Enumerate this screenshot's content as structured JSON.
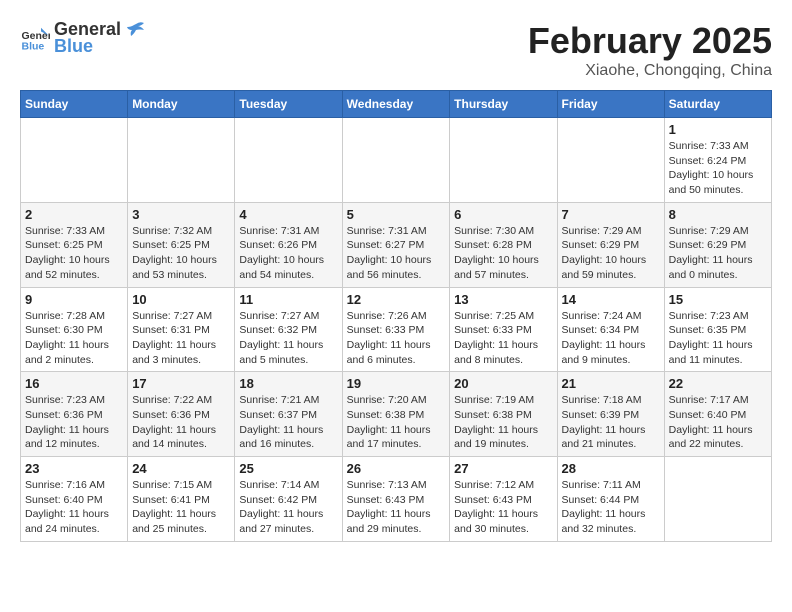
{
  "header": {
    "logo_general": "General",
    "logo_blue": "Blue",
    "title": "February 2025",
    "subtitle": "Xiaohe, Chongqing, China"
  },
  "weekdays": [
    "Sunday",
    "Monday",
    "Tuesday",
    "Wednesday",
    "Thursday",
    "Friday",
    "Saturday"
  ],
  "weeks": [
    [
      {
        "day": "",
        "info": ""
      },
      {
        "day": "",
        "info": ""
      },
      {
        "day": "",
        "info": ""
      },
      {
        "day": "",
        "info": ""
      },
      {
        "day": "",
        "info": ""
      },
      {
        "day": "",
        "info": ""
      },
      {
        "day": "1",
        "info": "Sunrise: 7:33 AM\nSunset: 6:24 PM\nDaylight: 10 hours\nand 50 minutes."
      }
    ],
    [
      {
        "day": "2",
        "info": "Sunrise: 7:33 AM\nSunset: 6:25 PM\nDaylight: 10 hours\nand 52 minutes."
      },
      {
        "day": "3",
        "info": "Sunrise: 7:32 AM\nSunset: 6:25 PM\nDaylight: 10 hours\nand 53 minutes."
      },
      {
        "day": "4",
        "info": "Sunrise: 7:31 AM\nSunset: 6:26 PM\nDaylight: 10 hours\nand 54 minutes."
      },
      {
        "day": "5",
        "info": "Sunrise: 7:31 AM\nSunset: 6:27 PM\nDaylight: 10 hours\nand 56 minutes."
      },
      {
        "day": "6",
        "info": "Sunrise: 7:30 AM\nSunset: 6:28 PM\nDaylight: 10 hours\nand 57 minutes."
      },
      {
        "day": "7",
        "info": "Sunrise: 7:29 AM\nSunset: 6:29 PM\nDaylight: 10 hours\nand 59 minutes."
      },
      {
        "day": "8",
        "info": "Sunrise: 7:29 AM\nSunset: 6:29 PM\nDaylight: 11 hours\nand 0 minutes."
      }
    ],
    [
      {
        "day": "9",
        "info": "Sunrise: 7:28 AM\nSunset: 6:30 PM\nDaylight: 11 hours\nand 2 minutes."
      },
      {
        "day": "10",
        "info": "Sunrise: 7:27 AM\nSunset: 6:31 PM\nDaylight: 11 hours\nand 3 minutes."
      },
      {
        "day": "11",
        "info": "Sunrise: 7:27 AM\nSunset: 6:32 PM\nDaylight: 11 hours\nand 5 minutes."
      },
      {
        "day": "12",
        "info": "Sunrise: 7:26 AM\nSunset: 6:33 PM\nDaylight: 11 hours\nand 6 minutes."
      },
      {
        "day": "13",
        "info": "Sunrise: 7:25 AM\nSunset: 6:33 PM\nDaylight: 11 hours\nand 8 minutes."
      },
      {
        "day": "14",
        "info": "Sunrise: 7:24 AM\nSunset: 6:34 PM\nDaylight: 11 hours\nand 9 minutes."
      },
      {
        "day": "15",
        "info": "Sunrise: 7:23 AM\nSunset: 6:35 PM\nDaylight: 11 hours\nand 11 minutes."
      }
    ],
    [
      {
        "day": "16",
        "info": "Sunrise: 7:23 AM\nSunset: 6:36 PM\nDaylight: 11 hours\nand 12 minutes."
      },
      {
        "day": "17",
        "info": "Sunrise: 7:22 AM\nSunset: 6:36 PM\nDaylight: 11 hours\nand 14 minutes."
      },
      {
        "day": "18",
        "info": "Sunrise: 7:21 AM\nSunset: 6:37 PM\nDaylight: 11 hours\nand 16 minutes."
      },
      {
        "day": "19",
        "info": "Sunrise: 7:20 AM\nSunset: 6:38 PM\nDaylight: 11 hours\nand 17 minutes."
      },
      {
        "day": "20",
        "info": "Sunrise: 7:19 AM\nSunset: 6:38 PM\nDaylight: 11 hours\nand 19 minutes."
      },
      {
        "day": "21",
        "info": "Sunrise: 7:18 AM\nSunset: 6:39 PM\nDaylight: 11 hours\nand 21 minutes."
      },
      {
        "day": "22",
        "info": "Sunrise: 7:17 AM\nSunset: 6:40 PM\nDaylight: 11 hours\nand 22 minutes."
      }
    ],
    [
      {
        "day": "23",
        "info": "Sunrise: 7:16 AM\nSunset: 6:40 PM\nDaylight: 11 hours\nand 24 minutes."
      },
      {
        "day": "24",
        "info": "Sunrise: 7:15 AM\nSunset: 6:41 PM\nDaylight: 11 hours\nand 25 minutes."
      },
      {
        "day": "25",
        "info": "Sunrise: 7:14 AM\nSunset: 6:42 PM\nDaylight: 11 hours\nand 27 minutes."
      },
      {
        "day": "26",
        "info": "Sunrise: 7:13 AM\nSunset: 6:43 PM\nDaylight: 11 hours\nand 29 minutes."
      },
      {
        "day": "27",
        "info": "Sunrise: 7:12 AM\nSunset: 6:43 PM\nDaylight: 11 hours\nand 30 minutes."
      },
      {
        "day": "28",
        "info": "Sunrise: 7:11 AM\nSunset: 6:44 PM\nDaylight: 11 hours\nand 32 minutes."
      },
      {
        "day": "",
        "info": ""
      }
    ]
  ]
}
